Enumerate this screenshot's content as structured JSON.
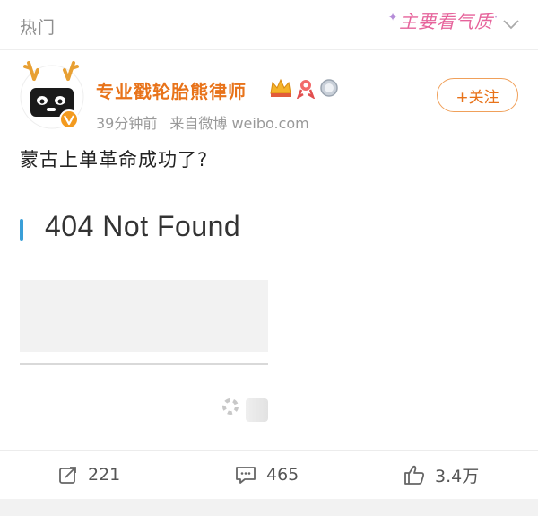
{
  "header": {
    "tab_label": "热门",
    "slogan": "主要看气质",
    "dropdown_icon": "chevron-down-icon"
  },
  "post": {
    "author": {
      "name": "专业戳轮胎熊律师",
      "avatar_icon": "bear-avatar-icon",
      "verified_icon": "verified-v-icon",
      "badges": [
        "crown-icon",
        "ribbon-icon",
        "medal-icon"
      ]
    },
    "time": "39分钟前",
    "source": "来自微博 weibo.com",
    "follow_label": "+关注",
    "text": "蒙古上单革命成功了?",
    "image": {
      "title": "404 Not Found"
    },
    "actions": {
      "repost_count": "221",
      "comment_count": "465",
      "like_count": "3.4万"
    }
  },
  "colors": {
    "accent_orange": "#e8731a",
    "slogan_pink": "#e6639b",
    "meta_gray": "#999999"
  }
}
